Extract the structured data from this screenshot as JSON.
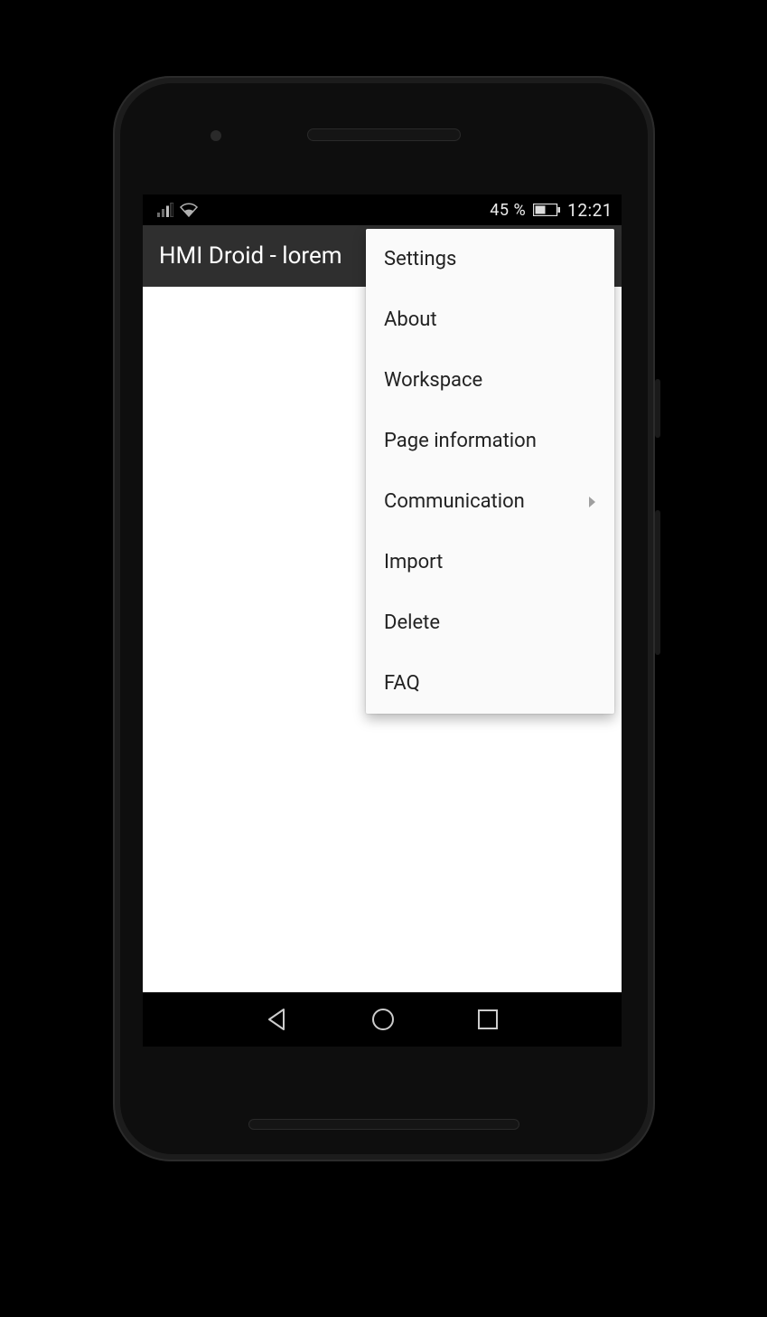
{
  "statusBar": {
    "batteryText": "45 %",
    "time": "12:21"
  },
  "appBar": {
    "title": "HMI Droid - lorem"
  },
  "menu": {
    "items": [
      {
        "label": "Settings",
        "hasSubmenu": false
      },
      {
        "label": "About",
        "hasSubmenu": false
      },
      {
        "label": "Workspace",
        "hasSubmenu": false
      },
      {
        "label": "Page information",
        "hasSubmenu": false
      },
      {
        "label": "Communication",
        "hasSubmenu": true
      },
      {
        "label": "Import",
        "hasSubmenu": false
      },
      {
        "label": "Delete",
        "hasSubmenu": false
      },
      {
        "label": "FAQ",
        "hasSubmenu": false
      }
    ]
  }
}
